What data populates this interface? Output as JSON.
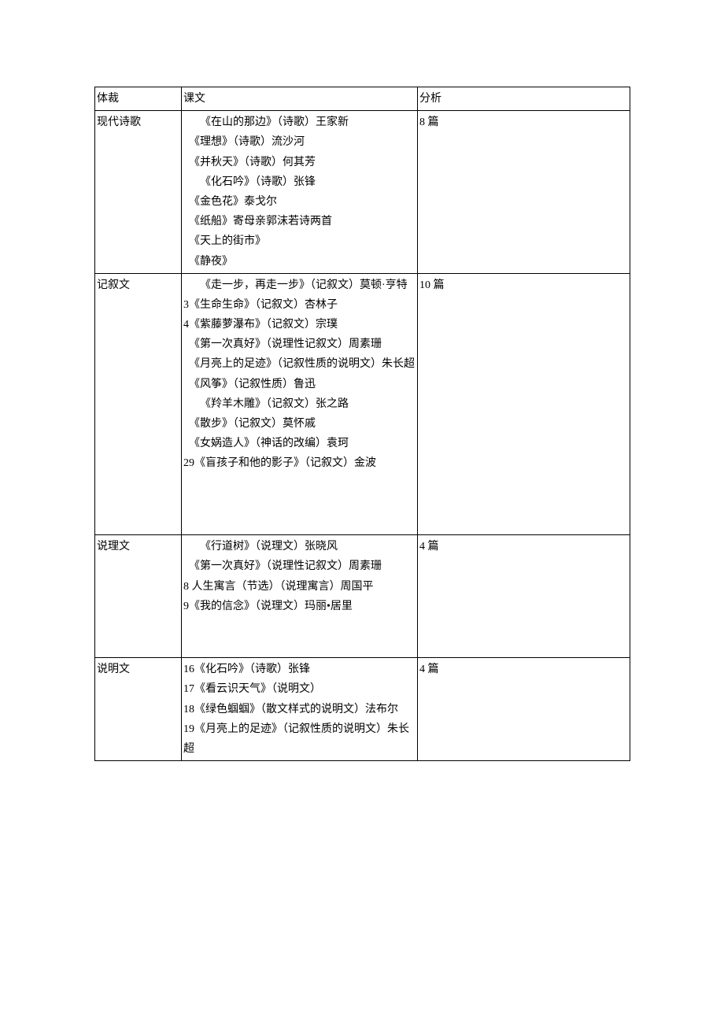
{
  "table": {
    "header": {
      "genre": "体裁",
      "text": "课文",
      "analysis": "分析"
    },
    "rows": [
      {
        "genre": "现代诗歌",
        "text": "　　《在山的那边》（诗歌）王家新\n　《理想》（诗歌）流沙河\n　《并秋天》（诗歌）何其芳\n　　《化石吟》（诗歌）张锋\n　《金色花》泰戈尔\n　《纸船》寄母亲郭沫若诗两首\n　《天上的街市》\n　《静夜》\n",
        "analysis": "8 篇"
      },
      {
        "genre": "记叙文",
        "text": "　　《走一步，再走一步》（记叙文）莫顿·亨特\n3《生命生命》（记叙文）杏林子\n4《紫藤萝瀑布》（记叙文）宗璞\n　《第一次真好》（说理性记叙文）周素珊\n　《月亮上的足迹》（记叙性质的说明文）朱长超\n　《风筝》（记叙性质）鲁迅\n　　《羚羊木雕》（记叙文）张之路\n　《散步》（记叙文）莫怀戚\n　《女娲造人》（神话的改编）袁珂\n29《盲孩子和他的影子》（记叙文）金波\n\n\n\n",
        "analysis": "10 篇"
      },
      {
        "genre": "说理文",
        "text": "　　《行道树》（说理文）张晓风\n　《第一次真好》（说理性记叙文）周素珊\n8 人生寓言（节选）（说理寓言）周国平\n9《我的信念》（说理文）玛丽•居里\n\n\n",
        "analysis": "4 篇"
      },
      {
        "genre": "说明文",
        "text": "16《化石吟》（诗歌）张锋\n17《看云识天气》（说明文）\n18《绿色蝈蝈》（散文样式的说明文）法布尔\n19《月亮上的足迹》（记叙性质的说明文）朱长超\n",
        "analysis": "4 篇"
      }
    ]
  }
}
